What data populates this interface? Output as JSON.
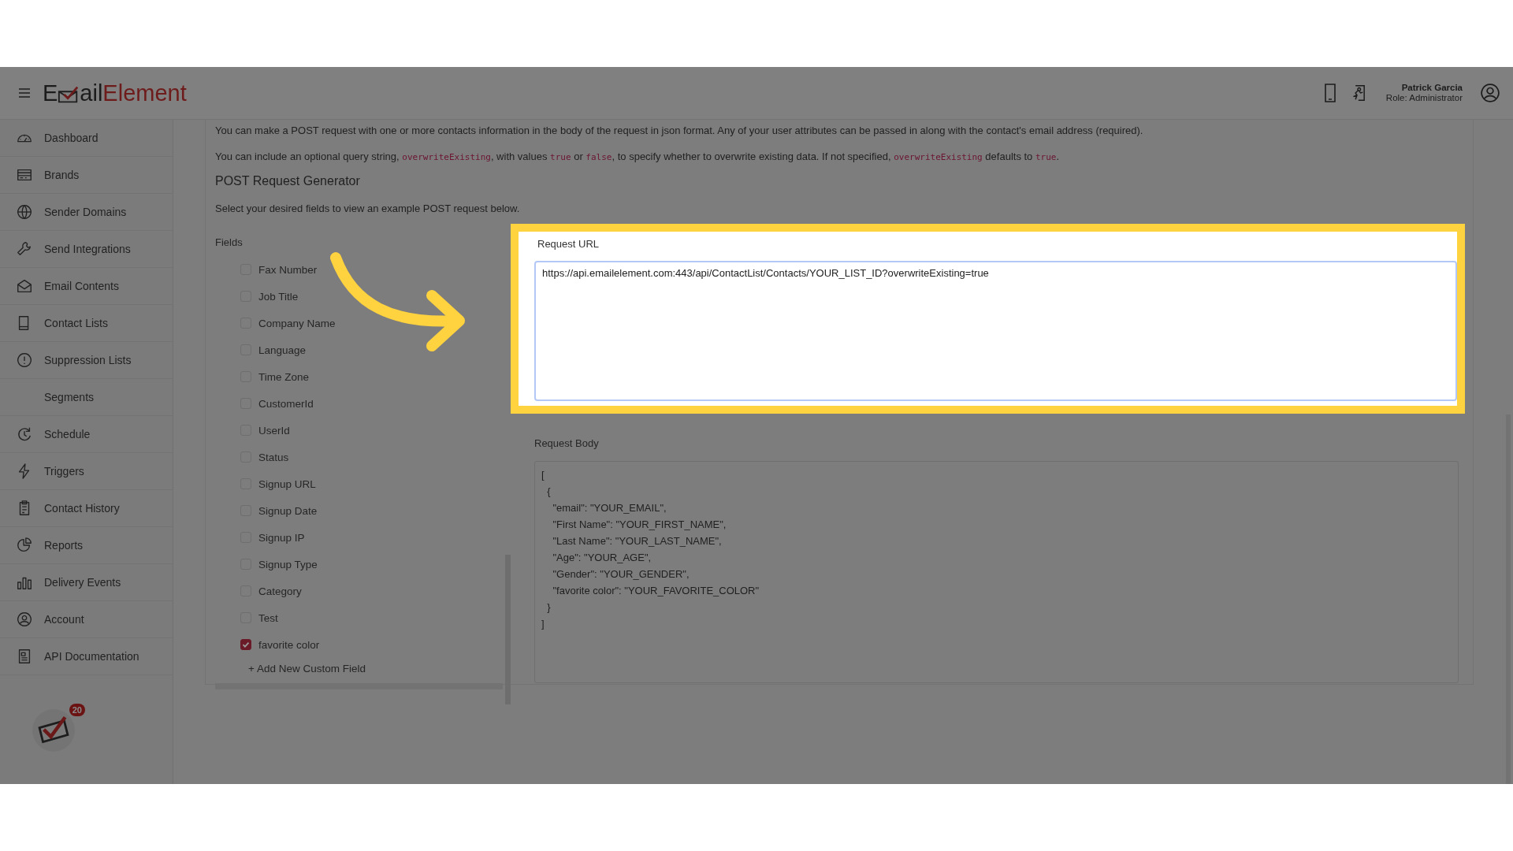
{
  "header": {
    "logo": {
      "prefix": "E",
      "middle": "ail",
      "brand": "Element"
    },
    "user": {
      "name": "Patrick Garcia",
      "role": "Role: Administrator"
    }
  },
  "sidebar": {
    "items": [
      {
        "label": "Dashboard"
      },
      {
        "label": "Brands"
      },
      {
        "label": "Sender Domains"
      },
      {
        "label": "Send Integrations"
      },
      {
        "label": "Email Contents"
      },
      {
        "label": "Contact Lists"
      },
      {
        "label": "Suppression Lists"
      },
      {
        "label": "Segments"
      },
      {
        "label": "Schedule"
      },
      {
        "label": "Triggers"
      },
      {
        "label": "Contact History"
      },
      {
        "label": "Reports"
      },
      {
        "label": "Delivery Events"
      },
      {
        "label": "Account"
      },
      {
        "label": "API Documentation"
      }
    ],
    "notification_badge": "20"
  },
  "intro": "You can make a POST request with one or more contacts information in the body of the request in json format. Any of your user attributes can be passed in along with the contact's email address (required).",
  "query_note": [
    {
      "kind": "text",
      "text": "You can include an optional query string, "
    },
    {
      "kind": "code",
      "text": "overwriteExisting"
    },
    {
      "kind": "text",
      "text": ", with values "
    },
    {
      "kind": "code",
      "text": "true"
    },
    {
      "kind": "text",
      "text": " or "
    },
    {
      "kind": "code",
      "text": "false"
    },
    {
      "kind": "text",
      "text": ", to specify whether to overwrite existing data. If not specified, "
    },
    {
      "kind": "code",
      "text": "overwriteExisting"
    },
    {
      "kind": "text",
      "text": " defaults to "
    },
    {
      "kind": "code",
      "text": "true"
    },
    {
      "kind": "text",
      "text": "."
    }
  ],
  "generator": {
    "title": "POST Request Generator",
    "hint": "Select your desired fields to view an example POST request below.",
    "fields_label": "Fields",
    "fields": [
      {
        "label": "Fax Number",
        "checked": false
      },
      {
        "label": "Job Title",
        "checked": false
      },
      {
        "label": "Company Name",
        "checked": false
      },
      {
        "label": "Language",
        "checked": false
      },
      {
        "label": "Time Zone",
        "checked": false
      },
      {
        "label": "CustomerId",
        "checked": false
      },
      {
        "label": "UserId",
        "checked": false
      },
      {
        "label": "Status",
        "checked": false
      },
      {
        "label": "Signup URL",
        "checked": false
      },
      {
        "label": "Signup Date",
        "checked": false
      },
      {
        "label": "Signup IP",
        "checked": false
      },
      {
        "label": "Signup Type",
        "checked": false
      },
      {
        "label": "Category",
        "checked": false
      },
      {
        "label": "Test",
        "checked": false
      },
      {
        "label": "favorite color",
        "checked": true
      }
    ],
    "add_field": "+ Add New Custom Field",
    "request_url": {
      "label": "Request URL",
      "value": "https://api.emailelement.com:443/api/ContactList/Contacts/YOUR_LIST_ID?overwriteExisting=true"
    },
    "request_body": {
      "label": "Request Body",
      "value": "[\n  {\n    \"email\": \"YOUR_EMAIL\",\n    \"First Name\": \"YOUR_FIRST_NAME\",\n    \"Last Name\": \"YOUR_LAST_NAME\",\n    \"Age\": \"YOUR_AGE\",\n    \"Gender\": \"YOUR_GENDER\",\n    \"favorite color\": \"YOUR_FAVORITE_COLOR\"\n  }\n]"
    }
  }
}
